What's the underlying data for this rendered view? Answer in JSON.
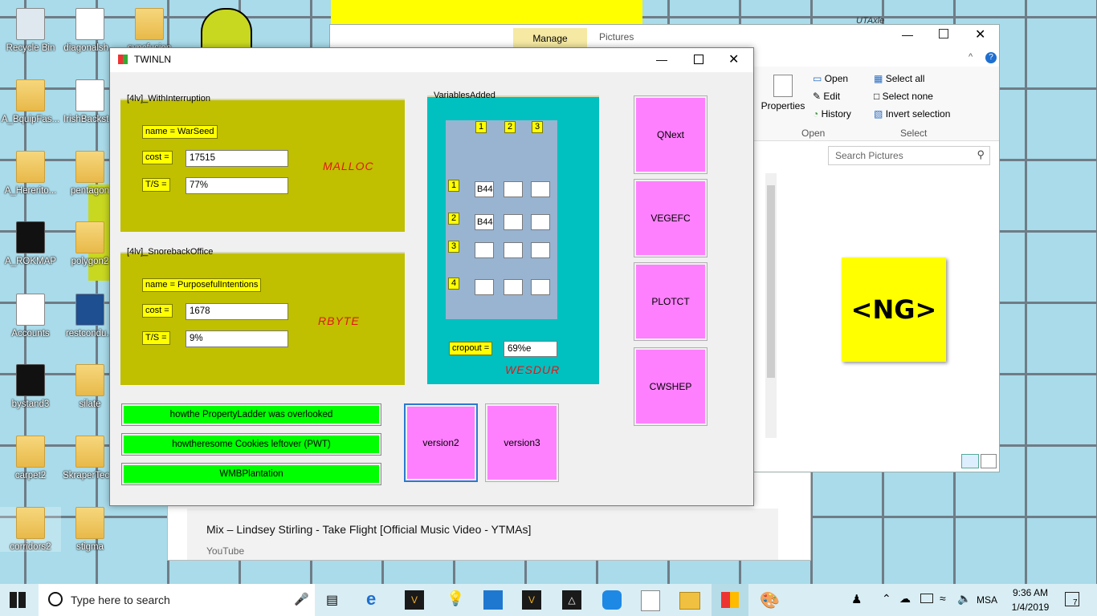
{
  "desktop": {
    "icons": [
      {
        "label": "Recycle Bin"
      },
      {
        "label": "diagonalsh..."
      },
      {
        "label": "syncfusion"
      },
      {
        "label": "A_BquipFas..."
      },
      {
        "label": "IrishBackst..."
      },
      {
        "label": "A_Hererito..."
      },
      {
        "label": "pentagon"
      },
      {
        "label": "A_ROKMAP"
      },
      {
        "label": "polygon2"
      },
      {
        "label": "Accounts"
      },
      {
        "label": "restcondu..."
      },
      {
        "label": "bystand3"
      },
      {
        "label": "silate"
      },
      {
        "label": "carpet2"
      },
      {
        "label": "SkraperTec..."
      },
      {
        "label": "corridors2"
      },
      {
        "label": "stigma"
      }
    ],
    "right_label": "UTAxle"
  },
  "explorer": {
    "manage_tab": "Manage",
    "pictures_tab": "Pictures",
    "ribbon": {
      "properties": "Properties",
      "open": "Open",
      "edit": "Edit",
      "history": "History",
      "open_group": "Open",
      "select_all": "Select all",
      "select_none": "Select none",
      "invert_selection": "Invert selection",
      "select_group": "Select"
    },
    "search_placeholder": "Search Pictures",
    "thumbnail_text": "<NG>"
  },
  "youtube": {
    "title": "Mix – Lindsey Stirling - Take Flight [Official Music Video - YTMAs]",
    "source": "YouTube"
  },
  "window": {
    "title": "TWINLN",
    "group1": {
      "legend": "[4lv]_WithInterruption",
      "name_label": "name = WarSeed",
      "cost_label": "cost =",
      "cost_value": "17515",
      "ts_label": "T/S =",
      "ts_value": "77%",
      "tag": "MALLOC"
    },
    "group2": {
      "legend": "[4lv]_SnorebackOffice",
      "name_label": "name = PurposefulIntentions",
      "cost_label": "cost =",
      "cost_value": "1678",
      "ts_label": "T/S =",
      "ts_value": "9%",
      "tag": "RBYTE"
    },
    "variables": {
      "legend": "VariablesAdded",
      "col_headers": [
        "1",
        "2",
        "3"
      ],
      "row_headers": [
        "1",
        "2",
        "3",
        "4"
      ],
      "cells": [
        [
          "B44",
          "",
          ""
        ],
        [
          "B44",
          "",
          ""
        ],
        [
          "",
          "",
          ""
        ],
        [
          "",
          "",
          ""
        ]
      ],
      "cropout_label": "cropout =",
      "cropout_value": "69%e",
      "tag": "WESDUR"
    },
    "side_buttons": [
      "QNext",
      "VEGEFC",
      "PLOTCT",
      "CWSHEP"
    ],
    "green_buttons": [
      "howthe PropertyLadder was overlooked",
      "howtheresome Cookies leftover (PWT)",
      "WMBPlantation"
    ],
    "version_buttons": [
      "version2",
      "version3"
    ]
  },
  "taskbar": {
    "search_placeholder": "Type here to search",
    "language": "MSA",
    "time": "9:36 AM",
    "date": "1/4/2019",
    "notification_count": "7"
  },
  "colors": {
    "olive": "#c0bf00",
    "teal": "#00c0c0",
    "pink": "#ff80ff",
    "green": "#00ff00",
    "yellow_label": "#ffff00",
    "red_tag": "#e01818"
  }
}
